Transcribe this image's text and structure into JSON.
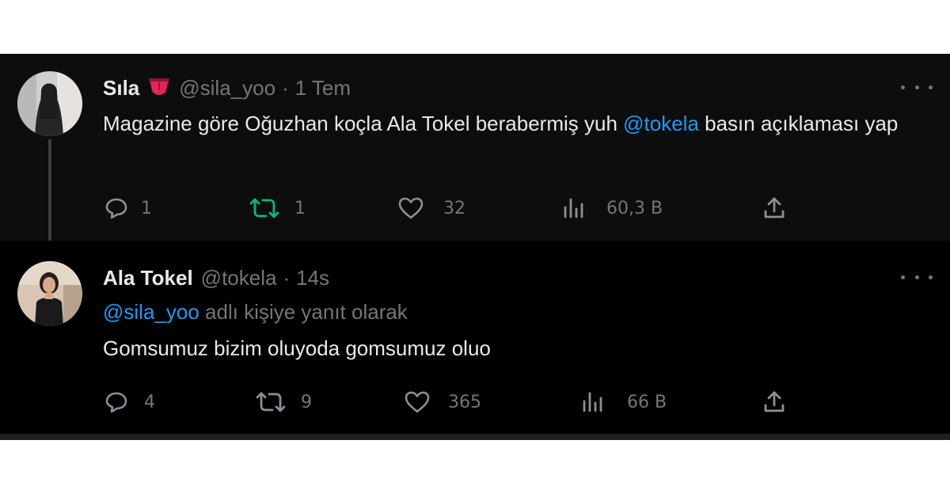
{
  "tweets": [
    {
      "name": "Sıla",
      "emoji": "tongue-emoji",
      "handle": "@sila_yoo",
      "separator": "·",
      "time": "1 Tem",
      "text_before": "Magazine göre Oğuzhan koçla Ala Tokel berabermiş yuh ",
      "mention": "@tokela",
      "text_after": " basın açıklaması yap",
      "replies": "1",
      "retweets": "1",
      "likes": "32",
      "views": "60,3 B",
      "retweet_color": "#00ba7c"
    },
    {
      "name": "Ala Tokel",
      "handle": "@tokela",
      "separator": "·",
      "time": "14s",
      "reply_to_mention": "@sila_yoo",
      "reply_to_text": " adlı kişiye yanıt olarak",
      "text": "Gomsumuz bizim oluyoda gomsumuz oluo",
      "replies": "4",
      "retweets": "9",
      "likes": "365",
      "views": "66 B"
    }
  ],
  "colors": {
    "background": "#000000",
    "text": "#e7e9ea",
    "muted": "#71767b",
    "link": "#1d9bf0"
  },
  "icons": [
    "reply-icon",
    "retweet-icon",
    "like-icon",
    "views-icon",
    "share-icon",
    "more-icon"
  ]
}
